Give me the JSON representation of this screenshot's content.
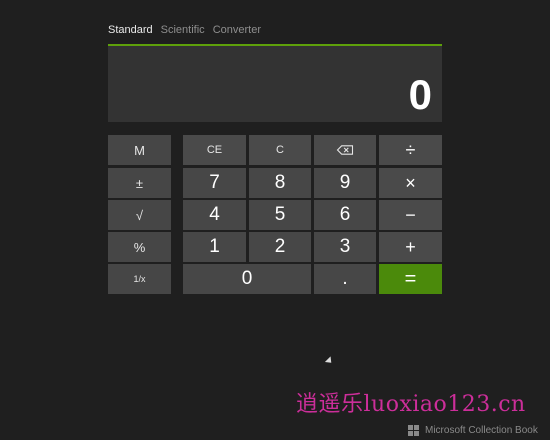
{
  "tabs": [
    "Standard",
    "Scientific",
    "Converter"
  ],
  "display": {
    "value": "0"
  },
  "keys": {
    "memory": "M",
    "plus_minus": "±",
    "sqrt": "√",
    "percent": "%",
    "reciprocal": "1/x",
    "ce": "CE",
    "c": "C",
    "divide": "÷",
    "multiply": "×",
    "minus": "−",
    "plus": "+",
    "equals": "=",
    "decimal": ".",
    "d0": "0",
    "d1": "1",
    "d2": "2",
    "d3": "3",
    "d4": "4",
    "d5": "5",
    "d6": "6",
    "d7": "7",
    "d8": "8",
    "d9": "9"
  },
  "watermark": {
    "site": "逍遥乐luoxiao123.cn",
    "brand": "Microsoft Collection Book"
  },
  "colors": {
    "accent": "#5ea00a",
    "equals": "#4b8a0b",
    "background": "#1f1f1f",
    "watermark": "#cc2e9a"
  }
}
